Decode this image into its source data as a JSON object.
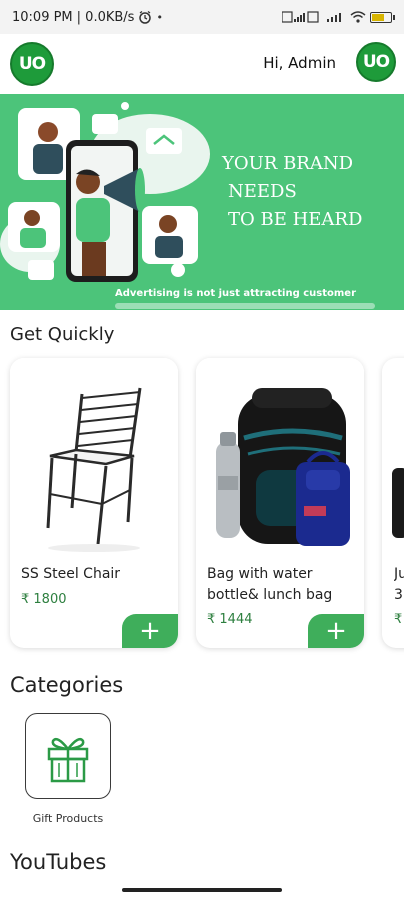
{
  "status_bar": {
    "time": "10:09 PM",
    "network": "| 0.0KB/s",
    "alarm_icon": "alarm-icon",
    "battery_level": 0.7
  },
  "header": {
    "logo_text": "UO",
    "greeting": "Hi, Admin"
  },
  "banner": {
    "headline": [
      "YOUR BRAND",
      "NEEDS",
      "TO BE HEARD"
    ],
    "caption": "Advertising is not just attracting customer",
    "background": "#4cc47a"
  },
  "sections": {
    "get_quickly": "Get Quickly",
    "categories": "Categories",
    "youtubes": "YouTubes"
  },
  "products": [
    {
      "name": "SS Steel Chair",
      "price": "₹ 1800",
      "add_label": "+"
    },
    {
      "name": "Bag with water bottle& lunch bag",
      "price": "₹ 1444",
      "add_label": "+"
    },
    {
      "name": "Ju",
      "name2": "3",
      "price": "₹",
      "add_label": "+"
    }
  ],
  "categories": [
    {
      "label": "Gift Products",
      "icon": "gift-box-icon"
    }
  ],
  "colors": {
    "accent": "#3fae5b",
    "brand": "#1e9b3a",
    "price": "#2d7f3f"
  }
}
